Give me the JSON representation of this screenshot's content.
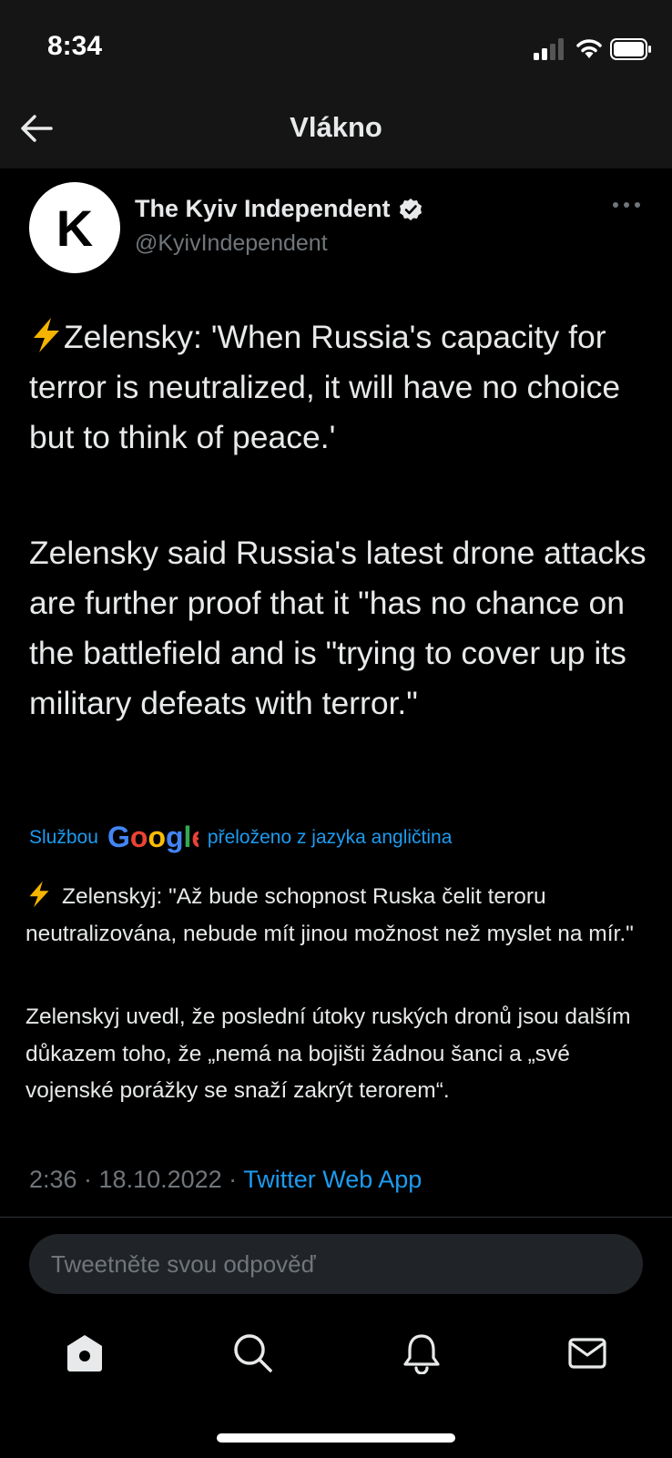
{
  "status_bar": {
    "time": "8:34"
  },
  "header": {
    "title": "Vlákno"
  },
  "tweet": {
    "author_name": "The Kyiv Independent",
    "handle": "@KyivIndependent",
    "avatar_letter": "K",
    "paragraph1": "Zelensky: 'When Russia's capacity for terror is neutralized, it will have no choice but to think of peace.'",
    "paragraph2": "Zelensky said Russia's latest drone attacks are further proof that it \"has no chance on the battlefield and is \"trying to cover up its military defeats with terror.\"",
    "timestamp": "2:36 · 18.10.2022 · ",
    "source": "Twitter Web App"
  },
  "translation": {
    "prefix": "Službou",
    "suffix": "přeloženo z jazyka angličtina",
    "paragraph1": "Zelenskyj: \"Až bude schopnost Ruska čelit teroru neutralizována, nebude mít jinou možnost než myslet na mír.\"",
    "paragraph2": "Zelenskyj uvedl, že poslední útoky ruských dronů jsou dalším důkazem toho, že „nemá na bojišti žádnou šanci a „své vojenské porážky se snaží zakrýt terorem“."
  },
  "reply": {
    "placeholder": "Tweetněte svou odpověď"
  },
  "colors": {
    "accent": "#1d9bf0",
    "background": "#000000",
    "muted": "#71767b",
    "header": "#151515"
  },
  "icons": [
    "signal-icon",
    "wifi-icon",
    "battery-icon",
    "back-arrow-icon",
    "verified-badge-icon",
    "more-icon",
    "lightning-icon",
    "google-logo",
    "home-icon",
    "search-icon",
    "bell-icon",
    "mail-icon"
  ]
}
